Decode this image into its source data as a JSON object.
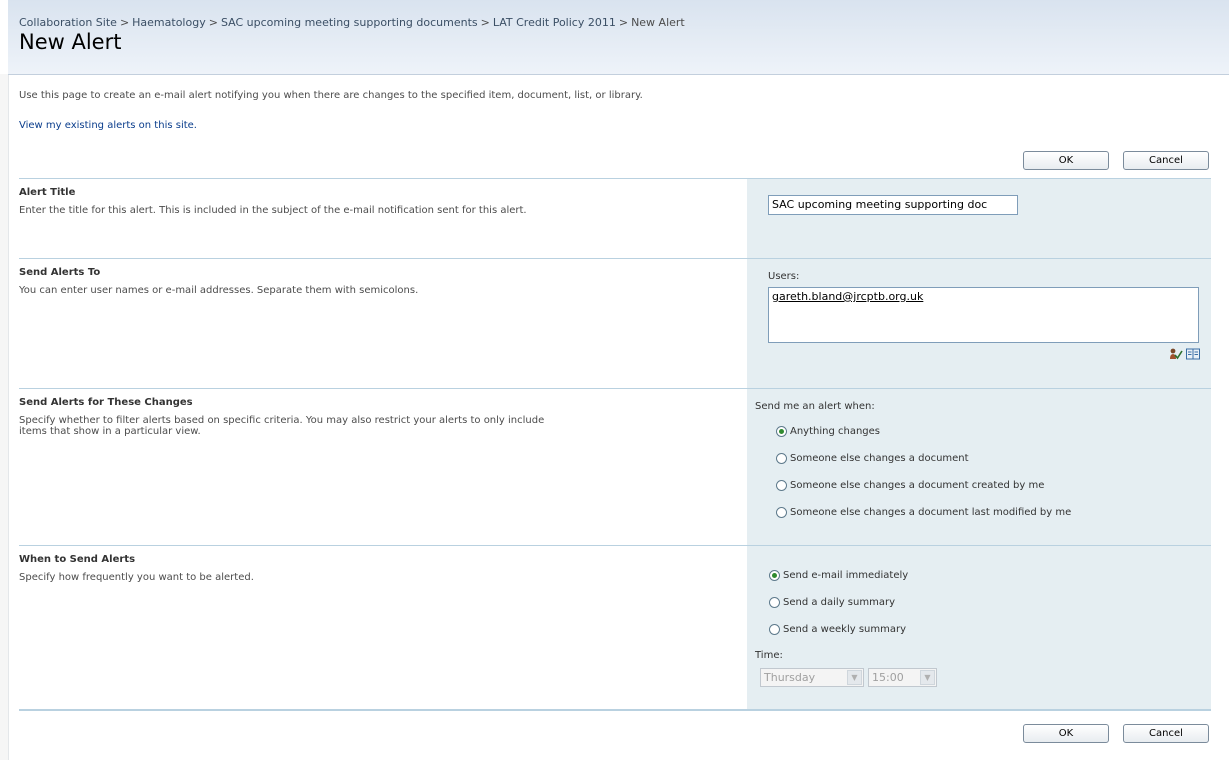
{
  "breadcrumb": {
    "items": [
      "Collaboration Site",
      "Haematology",
      "SAC upcoming meeting supporting documents",
      "LAT Credit Policy 2011"
    ],
    "separator": ">",
    "current": "New Alert"
  },
  "page_title": "New Alert",
  "intro_text": "Use this page to create an e-mail alert notifying you when there are changes to the specified item, document, list, or library.",
  "view_alerts_link": "View my existing alerts on this site.",
  "buttons": {
    "ok": "OK",
    "cancel": "Cancel"
  },
  "sections": {
    "alert_title": {
      "title": "Alert Title",
      "description": "Enter the title for this alert. This is included in the subject of the e-mail notification sent for this alert.",
      "value": "SAC upcoming meeting supporting doc"
    },
    "send_to": {
      "title": "Send Alerts To",
      "description": "You can enter user names or e-mail addresses. Separate them with semicolons.",
      "users_label": "Users:",
      "users_value": "gareth.bland@jrcptb.org.uk",
      "icons": [
        "check-names-icon",
        "address-book-icon"
      ]
    },
    "changes": {
      "title": "Send Alerts for These Changes",
      "description": "Specify whether to filter alerts based on specific criteria. You may also restrict your alerts to only include items that show in a particular view.",
      "prompt": "Send me an alert when:",
      "options": [
        "Anything changes",
        "Someone else changes a document",
        "Someone else changes a document created by me",
        "Someone else changes a document last modified by me"
      ],
      "selected": "Anything changes"
    },
    "when": {
      "title": "When to Send Alerts",
      "description": "Specify how frequently you want to be alerted.",
      "options": [
        "Send e-mail immediately",
        "Send a daily summary",
        "Send a weekly summary"
      ],
      "selected": "Send e-mail immediately",
      "time_label": "Time:",
      "day_value": "Thursday",
      "time_value": "15:00"
    }
  },
  "colors": {
    "header_bg": "#d9e3ef",
    "section_right_bg": "#e5eef2",
    "link": "#0a3d8c",
    "radio_selected": "#2f8a2f"
  }
}
